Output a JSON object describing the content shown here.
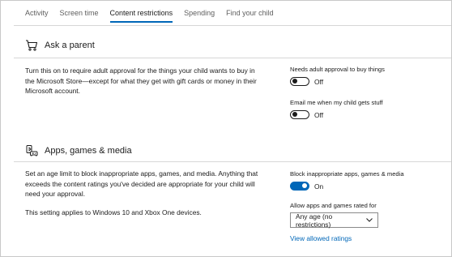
{
  "tabs": [
    {
      "label": "Activity",
      "active": false
    },
    {
      "label": "Screen time",
      "active": false
    },
    {
      "label": "Content restrictions",
      "active": true
    },
    {
      "label": "Spending",
      "active": false
    },
    {
      "label": "Find your child",
      "active": false
    }
  ],
  "ask_parent": {
    "icon": "cart-icon",
    "title": "Ask a parent",
    "description": "Turn this on to require adult approval for the things your child wants to buy in the Microsoft Store—except for what they get with gift cards or money in their Microsoft account.",
    "settings": [
      {
        "label": "Needs adult approval to buy things",
        "state": "Off",
        "on": false
      },
      {
        "label": "Email me when my child gets stuff",
        "state": "Off",
        "on": false
      }
    ]
  },
  "apps_media": {
    "icon": "apps-games-icon",
    "title": "Apps, games & media",
    "description": "Set an age limit to block inappropriate apps, games, and media. Anything that exceeds the content ratings you've decided are appropriate for your child will need your approval.",
    "note": "This setting applies to Windows 10 and Xbox One devices.",
    "block_setting": {
      "label": "Block inappropriate apps, games & media",
      "state": "On",
      "on": true
    },
    "age_setting": {
      "label": "Allow apps and games rated for",
      "selected": "Any age (no restrictions)"
    },
    "link": "View allowed ratings"
  },
  "colors": {
    "accent": "#0067b8",
    "text": "#1b1b1b",
    "muted": "#5f5f5f"
  }
}
